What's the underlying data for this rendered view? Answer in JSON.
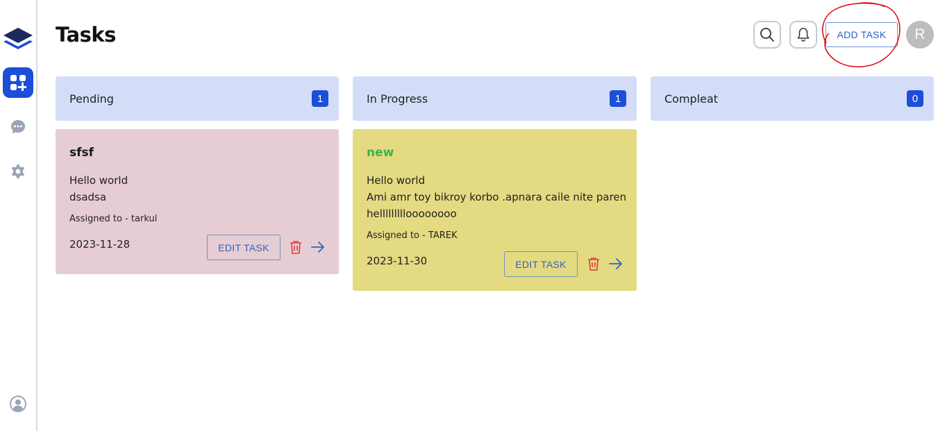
{
  "header": {
    "title": "Tasks",
    "add_task_label": "ADD TASK",
    "avatar_initial": "R"
  },
  "sidebar": {
    "items": [
      {
        "icon": "dashboard-icon",
        "active": true
      },
      {
        "icon": "chat-icon",
        "active": false
      },
      {
        "icon": "gear-icon",
        "active": false
      },
      {
        "icon": "user-circle-icon",
        "active": false
      }
    ]
  },
  "columns": [
    {
      "title": "Pending",
      "count": "1"
    },
    {
      "title": "In Progress",
      "count": "1"
    },
    {
      "title": "Compleat",
      "count": "0"
    }
  ],
  "cards": [
    {
      "title": "sfsf",
      "description": [
        "Hello world",
        "dsadsa"
      ],
      "assigned": "Assigned to - tarkul",
      "date": "2023-11-28",
      "edit_label": "EDIT TASK"
    },
    {
      "title": "new",
      "description": [
        "Hello world",
        "Ami amr toy bikroy korbo .apnara caile nite paren",
        "hellllllllloooooooo"
      ],
      "assigned": "Assigned to - TAREK",
      "date": "2023-11-30",
      "edit_label": "EDIT TASK"
    }
  ],
  "colors": {
    "accent": "#1d4ed8",
    "column_header_bg": "#d4ddf8",
    "pending_card_bg": "#e6cdd3",
    "progress_card_bg": "#e4da82",
    "title_green": "#39b54a",
    "delete_red": "#e53935",
    "annotation_red": "#e00000"
  }
}
